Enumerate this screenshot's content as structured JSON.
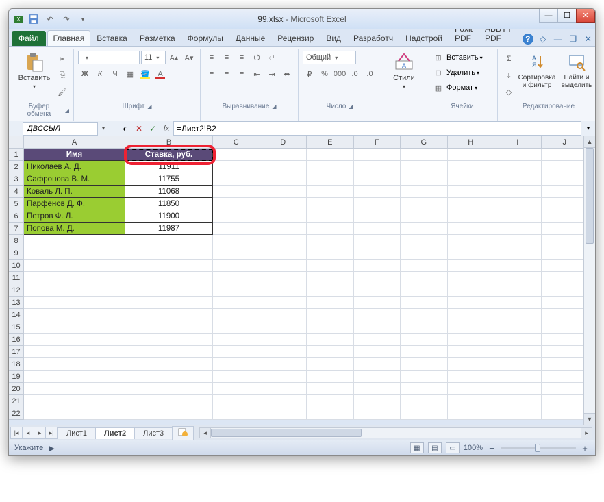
{
  "window": {
    "filename": "99.xlsx",
    "app": "Microsoft Excel"
  },
  "ribbon": {
    "file": "Файл",
    "tabs": [
      "Главная",
      "Вставка",
      "Разметка",
      "Формулы",
      "Данные",
      "Рецензир",
      "Вид",
      "Разработч",
      "Надстрой",
      "Foxit PDF",
      "ABBYY PDF"
    ],
    "active_tab": "Главная",
    "groups": {
      "clipboard": {
        "paste": "Вставить",
        "title": "Буфер обмена"
      },
      "font": {
        "name": "",
        "size": "11",
        "title": "Шрифт"
      },
      "alignment": {
        "title": "Выравнивание"
      },
      "number": {
        "format": "Общий",
        "title": "Число"
      },
      "styles": {
        "btn": "Стили",
        "title": ""
      },
      "cells": {
        "insert": "Вставить",
        "delete": "Удалить",
        "format": "Формат",
        "title": "Ячейки"
      },
      "editing": {
        "sort": "Сортировка и фильтр",
        "find": "Найти и выделить",
        "title": "Редактирование"
      }
    }
  },
  "formula": {
    "name_box": "ДВССЫЛ",
    "formula": "=Лист2!B2"
  },
  "columns": [
    "A",
    "B",
    "C",
    "D",
    "E",
    "F",
    "G",
    "H",
    "I",
    "J"
  ],
  "rows_shown": 22,
  "headers": {
    "A": "Имя",
    "B": "Ставка, руб."
  },
  "data": [
    {
      "name": "Николаев А. Д.",
      "value": "11911"
    },
    {
      "name": "Сафронова В. М.",
      "value": "11755"
    },
    {
      "name": "Коваль Л. П.",
      "value": "11068"
    },
    {
      "name": "Парфенов Д. Ф.",
      "value": "11850"
    },
    {
      "name": "Петров Ф. Л.",
      "value": "11900"
    },
    {
      "name": "Попова М. Д.",
      "value": "11987"
    }
  ],
  "highlight_cell": "B2",
  "tabs": {
    "sheets": [
      "Лист1",
      "Лист2",
      "Лист3"
    ],
    "active": "Лист2"
  },
  "status": {
    "mode": "Укажите",
    "zoom": "100%"
  }
}
